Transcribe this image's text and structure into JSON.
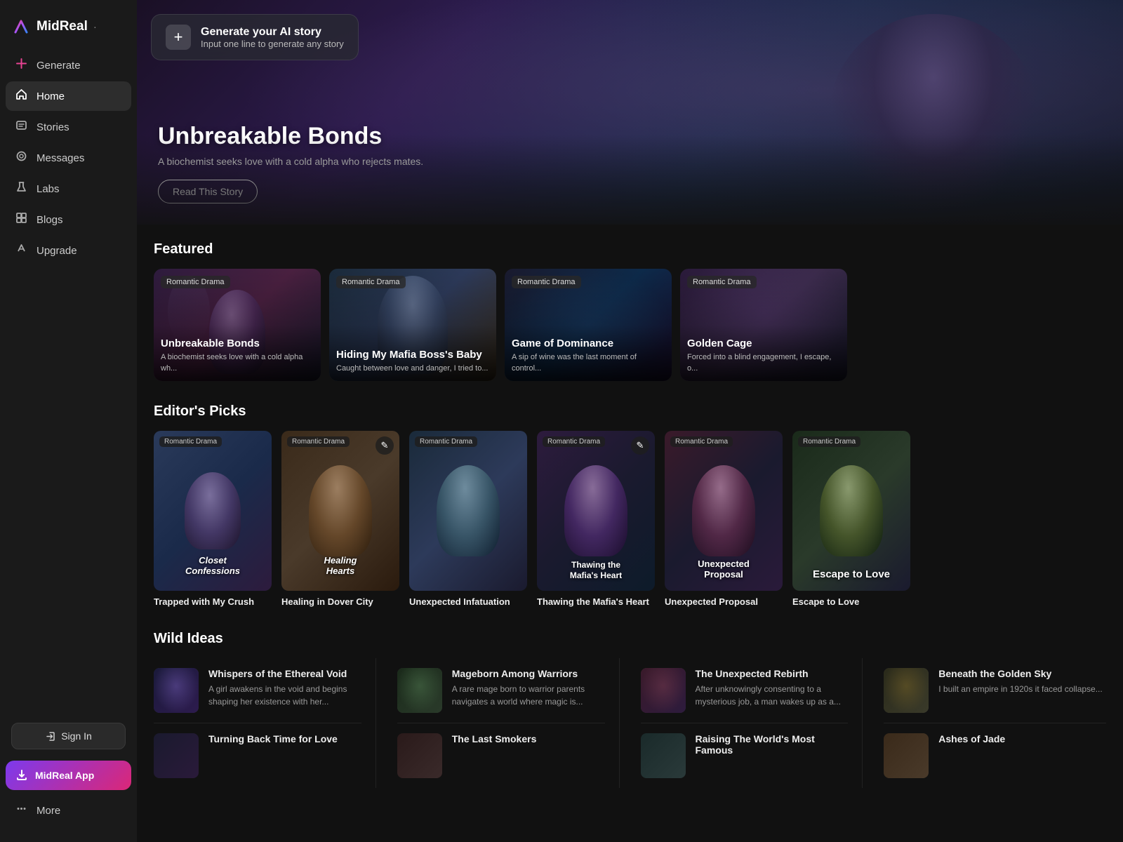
{
  "app": {
    "name": "MidReal",
    "tagline": "·"
  },
  "sidebar": {
    "nav_items": [
      {
        "id": "generate",
        "label": "Generate",
        "icon": "✦"
      },
      {
        "id": "home",
        "label": "Home",
        "icon": "⌂",
        "active": true
      },
      {
        "id": "stories",
        "label": "Stories",
        "icon": "◫"
      },
      {
        "id": "messages",
        "label": "Messages",
        "icon": "◎"
      },
      {
        "id": "labs",
        "label": "Labs",
        "icon": "⚗"
      },
      {
        "id": "blogs",
        "label": "Blogs",
        "icon": "▦"
      },
      {
        "id": "upgrade",
        "label": "Upgrade",
        "icon": "✎"
      }
    ],
    "sign_in": "Sign In",
    "midreal_app": "MidReal App",
    "more": "More"
  },
  "hero": {
    "generate_title": "Generate your AI story",
    "generate_subtitle": "Input one line to generate any story",
    "title": "Unbreakable Bonds",
    "description": "A biochemist seeks love with a cold alpha who rejects mates.",
    "read_button": "Read This Story"
  },
  "featured": {
    "section_title": "Featured",
    "badge": "Romantic Drama",
    "items": [
      {
        "title": "Unbreakable Bonds",
        "description": "A biochemist seeks love with a cold alpha wh..."
      },
      {
        "title": "Hiding My Mafia Boss's Baby",
        "description": "Caught between love and danger, I tried to..."
      },
      {
        "title": "Game of Dominance",
        "description": "A sip of wine was the last moment of control..."
      },
      {
        "title": "Golden Cage",
        "description": "Forced into a blind engagement, I escape, o..."
      }
    ]
  },
  "editors_picks": {
    "section_title": "Editor's Picks",
    "items": [
      {
        "title": "Trapped with My Crush",
        "badge": "Romantic Drama"
      },
      {
        "title": "Healing in Dover City",
        "badge": "Romantic Drama"
      },
      {
        "title": "Unexpected Infatuation",
        "badge": "Romantic Drama"
      },
      {
        "title": "Thawing the Mafia's Heart",
        "badge": "Romantic Drama"
      },
      {
        "title": "Unexpected Proposal",
        "badge": "Romantic Drama"
      },
      {
        "title": "Escape to Love",
        "badge": "Romantic Drama"
      }
    ]
  },
  "wild_ideas": {
    "section_title": "Wild Ideas",
    "items": [
      {
        "title": "Whispers of the Ethereal Void",
        "description": "A girl awakens in the void and begins shaping her existence with her..."
      },
      {
        "title": "Mageborn Among Warriors",
        "description": "A rare mage born to warrior parents navigates a world where magic is..."
      },
      {
        "title": "The Unexpected Rebirth",
        "description": "After unknowingly consenting to a mysterious job, a man wakes up as a..."
      },
      {
        "title": "Beneath the Golden Sky",
        "description": "I built an empire in 1920s it faced collapse..."
      },
      {
        "title": "Turning Back Time for Love",
        "description": ""
      },
      {
        "title": "The Last Smokers",
        "description": ""
      },
      {
        "title": "Raising The World's Most Famous",
        "description": ""
      },
      {
        "title": "Ashes of Jade",
        "description": ""
      }
    ]
  }
}
